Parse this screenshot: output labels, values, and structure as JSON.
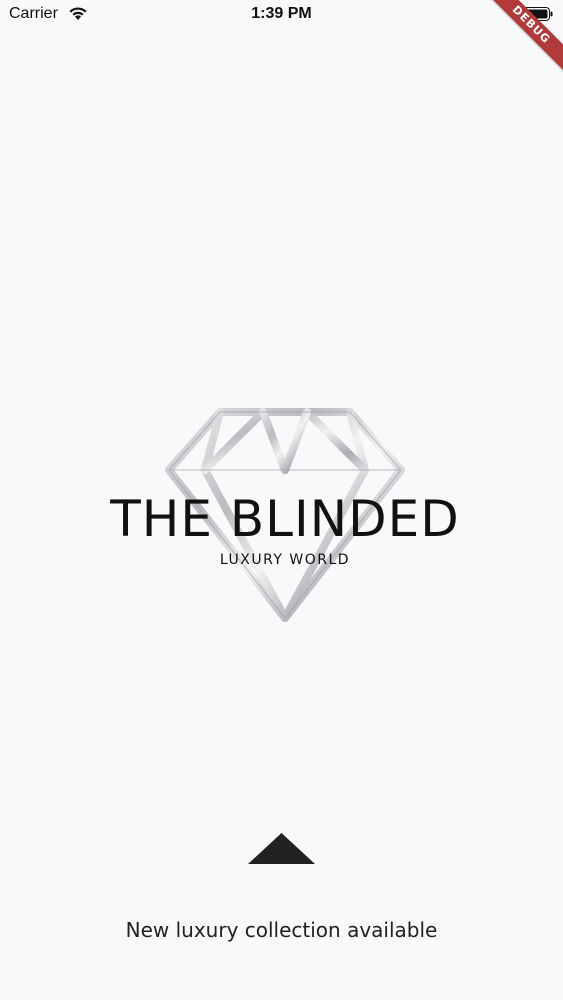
{
  "status_bar": {
    "carrier": "Carrier",
    "time": "1:39 PM",
    "wifi_icon": "wifi-icon",
    "battery_icon": "battery-icon"
  },
  "debug_banner": {
    "label": "DEBUG",
    "color": "#b13a3a"
  },
  "logo": {
    "icon": "diamond-icon",
    "title": "THE BLINDED",
    "subtitle": "LUXURY WORLD"
  },
  "swipe_hint": {
    "icon": "up-arrow-icon",
    "text": "New luxury collection available"
  },
  "colors": {
    "background": "#f9f9fb",
    "text": "#111111",
    "arrow": "#222222"
  }
}
